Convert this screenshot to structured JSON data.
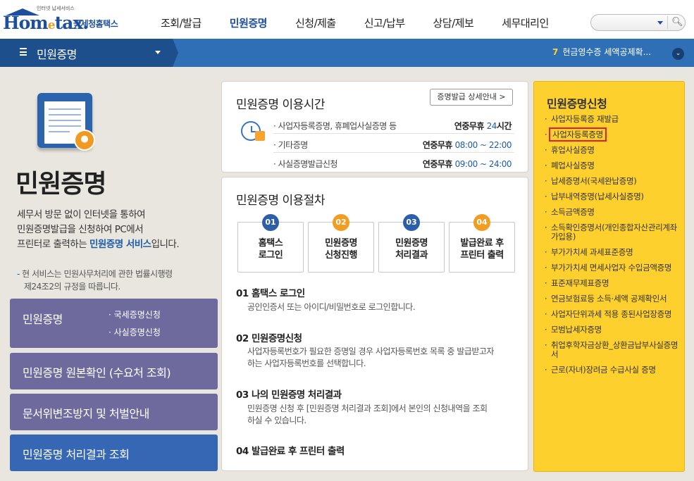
{
  "header": {
    "logo_small": "인터넷 납세서비스",
    "logo_home": "Hom",
    "logo_e": "e",
    "logo_tax": "tax.",
    "logo_kr": "국세청홈택스",
    "nav": [
      "조회/발급",
      "민원증명",
      "신청/제출",
      "신고/납부",
      "상담/제보",
      "세무대리인"
    ],
    "active_nav": "민원증명"
  },
  "bar": {
    "title": "민원증명",
    "notice_num": "7",
    "notice_text": "현금영수증 세액공제확..."
  },
  "left": {
    "big_title": "민원증명",
    "desc_1": "세무서 방문 없이 인터넷을 통하여",
    "desc_2": "민원증명발급을 신청하여 PC에서",
    "desc_3a": "프린터로 출력하는 ",
    "desc_3b": "민원증명 서비스",
    "desc_3c": "입니다.",
    "note_1": "현 서비스는 민원사무처리에 관한 법률시행령",
    "note_2": "제24조2의 규정을 따릅니다.",
    "box1_title": "민원증명",
    "box1_sub1": "· 국세증명신청",
    "box1_sub2": "· 사실증명신청",
    "box2": "민원증명 원본확인 (수요처 조회)",
    "box3": "문서위변조방지 및 처벌안내",
    "box4": "민원증명 처리결과 조회"
  },
  "hours": {
    "title": "민원증명 이용시간",
    "detail_btn": "증명발급 상세안내 >",
    "rows": [
      {
        "label": "· 사업자등록증명, 휴폐업사실증명 등",
        "pre": "연중무휴 ",
        "time": "24",
        "post": "시간"
      },
      {
        "label": "· 기타증명",
        "pre": "연중무휴 ",
        "time": "08:00 ~ 22:00",
        "post": ""
      },
      {
        "label": "· 사실증명발급신청",
        "pre": "연중무휴 ",
        "time": "09:00 ~ 24:00",
        "post": ""
      }
    ]
  },
  "procedure": {
    "title": "민원증명 이용절차",
    "steps": [
      {
        "num": "01",
        "l1": "홈택스",
        "l2": "로그인"
      },
      {
        "num": "02",
        "l1": "민원증명",
        "l2": "신청진행"
      },
      {
        "num": "03",
        "l1": "민원증명",
        "l2": "처리결과"
      },
      {
        "num": "04",
        "l1": "발급완료 후",
        "l2": "프린터 출력"
      }
    ],
    "p1_h": "01 홈택스 로그인",
    "p1_d": "공인인증서 또는 아이디/비밀번호로 로그인합니다.",
    "p2_h": "02 민원증명신청",
    "p2_d1": "사업자등록번호가 필요한 증명일 경우 사업자등록번호 목록 중 발급받고자",
    "p2_d2": "하는 사업자등록번호를 선택합니다.",
    "p3_h": "03 나의 민원증명 처리결과",
    "p3_d1": "민원증명 신청 후 [민원증명 처리결과 조회]에서 본인의 신청내역을 조회",
    "p3_d2": "하실 수 있습니다.",
    "p4_h": "04 발급완료 후 프린터 출력"
  },
  "right": {
    "title": "민원증명신청",
    "items": [
      "사업자등록증 재발급",
      "사업자등록증명",
      "휴업사실증명",
      "폐업사실증명",
      "납세증명서(국세완납증명)",
      "납부내역증명(납세사실증명)",
      "소득금액증명",
      "소득확인증명서(개인종합자산관리계좌 가입용)",
      "부가가치세 과세표준증명",
      "부가가치세 면세사업자 수입금액증명",
      "표준재무제표증명",
      "연금보험료등 소득·세액 공제확인서",
      "사업자단위과세 적용 종된사업장증명",
      "모범납세자증명",
      "취업후학자금상환_상환금납부사실증명서",
      "근로(자녀)장려금 수급사실 증명"
    ],
    "selected_index": 1
  },
  "colors": {
    "brand_blue": "#1e4f9c",
    "bar_blue": "#2f6fb6",
    "panel_yellow": "#fdd02d",
    "box_purple": "#6e6a9e",
    "box_blue": "#3567b4",
    "highlight_red": "#e02020"
  }
}
